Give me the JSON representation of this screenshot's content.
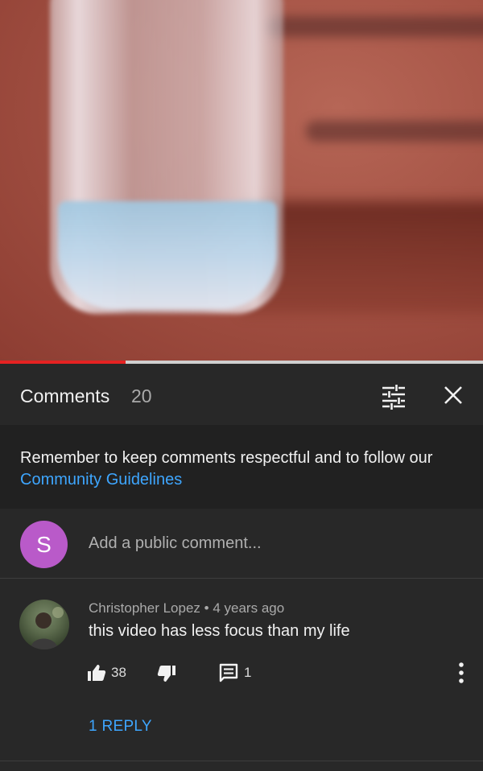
{
  "video": {
    "progress_fraction": 0.26
  },
  "comments_panel": {
    "title": "Comments",
    "count": "20",
    "filter_icon": "sort-filter-icon",
    "close_icon": "close-icon"
  },
  "notice": {
    "text": "Remember to keep comments respectful and to follow our ",
    "link": "Community Guidelines"
  },
  "add_comment": {
    "avatar_letter": "S",
    "avatar_color": "#b95ac9",
    "placeholder": "Add a public comment..."
  },
  "comments": [
    {
      "author": "Christopher Lopez",
      "separator": "•",
      "time": "4 years ago",
      "text": "this video has less focus than my life",
      "likes": "38",
      "replies": "1",
      "view_replies_label": "1 REPLY"
    }
  ],
  "colors": {
    "background": "#282828",
    "notice_background": "#212121",
    "link": "#3ea6ff",
    "progress": "#e52222"
  }
}
